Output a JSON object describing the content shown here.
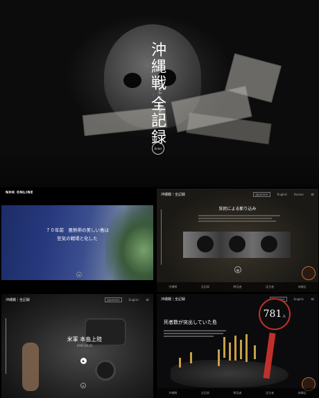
{
  "hero": {
    "title": "沖縄戦",
    "subtitle": "BATTLE OF OKINAWA",
    "title2": "全記録",
    "enter_label": "Enter"
  },
  "panel1": {
    "logo": "NHK ONLINE",
    "line1": "７０年前　亜熱帯の美しい島は",
    "line2": "狂気の戦場と化した"
  },
  "panel2": {
    "brand": "沖縄戦｜全記録",
    "lang": [
      "Japanese",
      "English",
      "Korean"
    ],
    "heading": "狂民による斬り込み",
    "nav": [
      "沖縄戦",
      "全記録",
      "戦没者",
      "証言者",
      "体験記"
    ]
  },
  "panel3": {
    "brand": "沖縄戦｜全記録",
    "lang": [
      "Japanese",
      "English"
    ],
    "heading": "米軍 本島上陸",
    "date": "1945.04.01"
  },
  "panel4": {
    "brand": "沖縄戦｜全記録",
    "lang": [
      "Japanese",
      "English"
    ],
    "count": "781",
    "count_unit": "人",
    "heading": "死者数が突出していた島"
  }
}
